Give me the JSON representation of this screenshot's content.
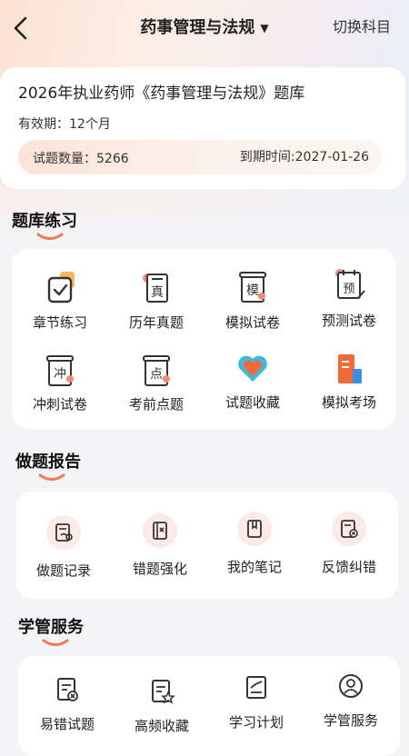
{
  "header": {
    "title": "药事管理与法规",
    "switch_label": "切换科目"
  },
  "info": {
    "bank_title": "2026年执业药师《药事管理与法规》题库",
    "validity": "有效期：12个月",
    "question_count": "试题数量：5266",
    "expire": "到期时间:2027-01-26"
  },
  "practice": {
    "title": "题库练习",
    "items": [
      {
        "label": "章节练习",
        "icon": "checkbox-doc-icon"
      },
      {
        "label": "历年真题",
        "icon": "true-paper-icon"
      },
      {
        "label": "模拟试卷",
        "icon": "mock-paper-icon"
      },
      {
        "label": "预测试卷",
        "icon": "predict-paper-icon"
      },
      {
        "label": "冲刺试卷",
        "icon": "sprint-paper-icon"
      },
      {
        "label": "考前点题",
        "icon": "key-points-icon"
      },
      {
        "label": "试题收藏",
        "icon": "heart-icon"
      },
      {
        "label": "模拟考场",
        "icon": "exam-room-icon"
      }
    ]
  },
  "report": {
    "title": "做题报告",
    "items": [
      {
        "label": "做题记录",
        "icon": "record-icon"
      },
      {
        "label": "错题强化",
        "icon": "mistake-icon"
      },
      {
        "label": "我的笔记",
        "icon": "note-icon"
      },
      {
        "label": "反馈纠错",
        "icon": "feedback-icon"
      }
    ]
  },
  "service": {
    "title": "学管服务",
    "items": [
      {
        "label": "易错试题",
        "icon": "error-prone-icon"
      },
      {
        "label": "高频收藏",
        "icon": "frequent-star-icon"
      },
      {
        "label": "学习计划",
        "icon": "study-plan-icon"
      },
      {
        "label": "学管服务",
        "icon": "service-person-icon"
      }
    ]
  },
  "colors": {
    "accent": "#f07a55",
    "brand_orange": "#f26a3a",
    "blue": "#3b8fe0"
  }
}
